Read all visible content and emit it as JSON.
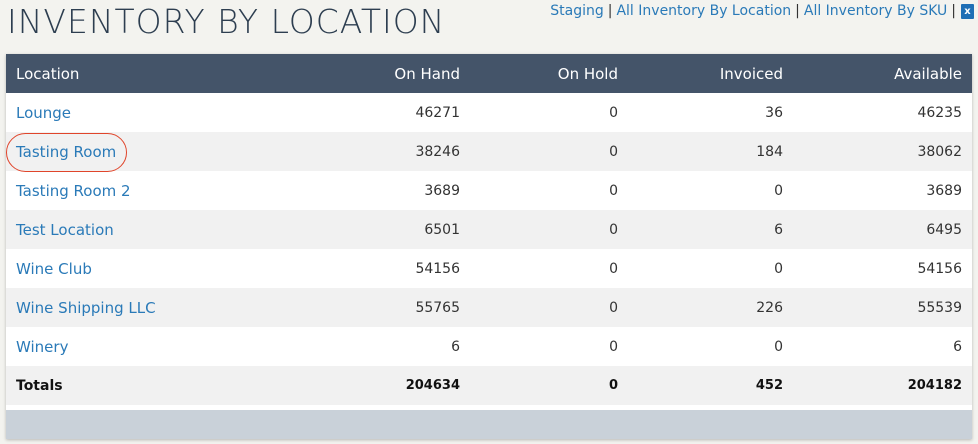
{
  "page": {
    "title": "INVENTORY BY LOCATION"
  },
  "top_links": [
    {
      "label": "Staging"
    },
    {
      "label": "All Inventory By Location"
    },
    {
      "label": "All Inventory By SKU"
    }
  ],
  "excel_icon": {
    "icon": "excel-export-icon",
    "glyph": "x"
  },
  "table": {
    "columns": [
      "Location",
      "On Hand",
      "On Hold",
      "Invoiced",
      "Available"
    ],
    "rows": [
      {
        "location": "Lounge",
        "on_hand": "46271",
        "on_hold": "0",
        "invoiced": "36",
        "available": "46235"
      },
      {
        "location": "Tasting Room",
        "on_hand": "38246",
        "on_hold": "0",
        "invoiced": "184",
        "available": "38062"
      },
      {
        "location": "Tasting Room 2",
        "on_hand": "3689",
        "on_hold": "0",
        "invoiced": "0",
        "available": "3689"
      },
      {
        "location": "Test Location",
        "on_hand": "6501",
        "on_hold": "0",
        "invoiced": "6",
        "available": "6495"
      },
      {
        "location": "Wine Club",
        "on_hand": "54156",
        "on_hold": "0",
        "invoiced": "0",
        "available": "54156"
      },
      {
        "location": "Wine Shipping LLC",
        "on_hand": "55765",
        "on_hold": "0",
        "invoiced": "226",
        "available": "55539"
      },
      {
        "location": "Winery",
        "on_hand": "6",
        "on_hold": "0",
        "invoiced": "0",
        "available": "6"
      }
    ],
    "totals": {
      "label": "Totals",
      "on_hand": "204634",
      "on_hold": "0",
      "invoiced": "452",
      "available": "204182"
    }
  },
  "colors": {
    "header_bg": "#445469",
    "link": "#2a7ab8",
    "highlight": "#e0452b",
    "footer_bg": "#c9d1d9"
  }
}
